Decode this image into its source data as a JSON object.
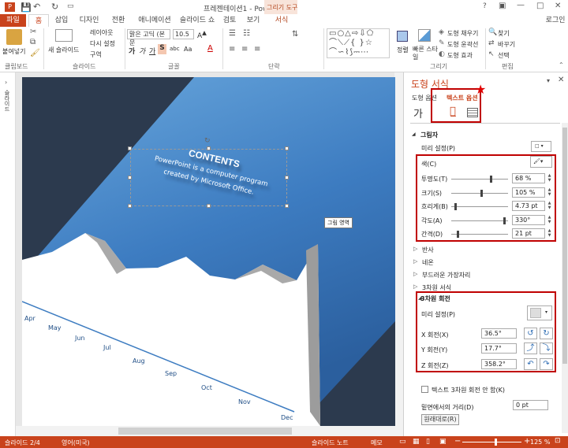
{
  "titlebar": {
    "title": "프레젠테이션1 - PowerPoint",
    "context_tab_group": "그리기 도구",
    "app_icon": "powerpoint-icon",
    "window_buttons": [
      "?",
      "□",
      "—",
      "□",
      "✕"
    ]
  },
  "tabs": {
    "file": "파일",
    "items": [
      "홈",
      "삽입",
      "디자인",
      "전환",
      "애니메이션",
      "슬라이드 쇼",
      "검토",
      "보기"
    ],
    "context": "서식",
    "login": "로그인"
  },
  "ribbon": {
    "clipboard": {
      "paste": "붙여넣기",
      "label": "클립보드"
    },
    "slides": {
      "new_slide": "새 슬라이드",
      "layout": "레이아웃",
      "reset": "다시 설정",
      "section": "구역",
      "label": "슬라이드"
    },
    "font": {
      "name": "맑은 고딕 (본문",
      "size": "10.5",
      "bold": "가",
      "italic": "가",
      "underline": "가",
      "strike": "가",
      "shadow": "S",
      "spacing": "abc",
      "case": "Aa",
      "label": "글꼴"
    },
    "paragraph": {
      "label": "단락"
    },
    "drawing": {
      "arrange": "정렬",
      "quick_styles": "빠른 스타일",
      "fill": "도형 채우기",
      "outline": "도형 윤곽선",
      "effects": "도형 효과",
      "label": "그리기"
    },
    "editing": {
      "find": "찾기",
      "replace": "바꾸기",
      "select": "선택",
      "label": "편집"
    }
  },
  "slide": {
    "title": "CONTENTS",
    "body_line1": "PowerPoint is a computer program",
    "body_line2": "created by Microsoft Office.",
    "tooltip": "그림 영역",
    "months": [
      "Apr",
      "May",
      "Jun",
      "Jul",
      "Aug",
      "Sep",
      "Oct",
      "Nov",
      "Dec"
    ]
  },
  "pane": {
    "title": "도형 서식",
    "tab_shape": "도형 옵션",
    "tab_text": "텍스트 옵션",
    "text_icon": "가",
    "shadow": {
      "header": "그림자",
      "preset": "미리 설정(P)",
      "color": "색(C)",
      "transparency": "투명도(T)",
      "transparency_value": "68 %",
      "transparency_pct": 68,
      "size": "크기(S)",
      "size_value": "105 %",
      "size_pct": 52,
      "blur": "흐리게(B)",
      "blur_value": "4.73 pt",
      "blur_pct": 5,
      "angle": "각도(A)",
      "angle_value": "330°",
      "angle_pct": 92,
      "distance": "간격(D)",
      "distance_value": "21 pt",
      "distance_pct": 10
    },
    "sections": [
      "반사",
      "네온",
      "부드러운 가장자리",
      "3차원 서식"
    ],
    "rotation": {
      "header": "3차원 회전",
      "preset": "미리 설정(P)",
      "x": "X 회전(X)",
      "x_value": "36.5°",
      "y": "Y 회전(Y)",
      "y_value": "17.7°",
      "z": "Z 회전(Z)",
      "z_value": "358.2°"
    },
    "keep_flat": "텍스트 3차원 회전 안 함(K)",
    "distance_ground": "밑면에서의 거리(D)",
    "distance_ground_value": "0 pt",
    "reset": "원래대로(R)"
  },
  "status": {
    "slide": "슬라이드 2/4",
    "lang": "영어(미국)",
    "notes": "슬라이드 노트",
    "comments": "메모",
    "zoom": "125 %"
  },
  "colors": {
    "accent": "#c9431c",
    "highlight": "#c00000",
    "slide_blue": "#3d7cc1",
    "slide_dark": "#2c3a4e"
  }
}
